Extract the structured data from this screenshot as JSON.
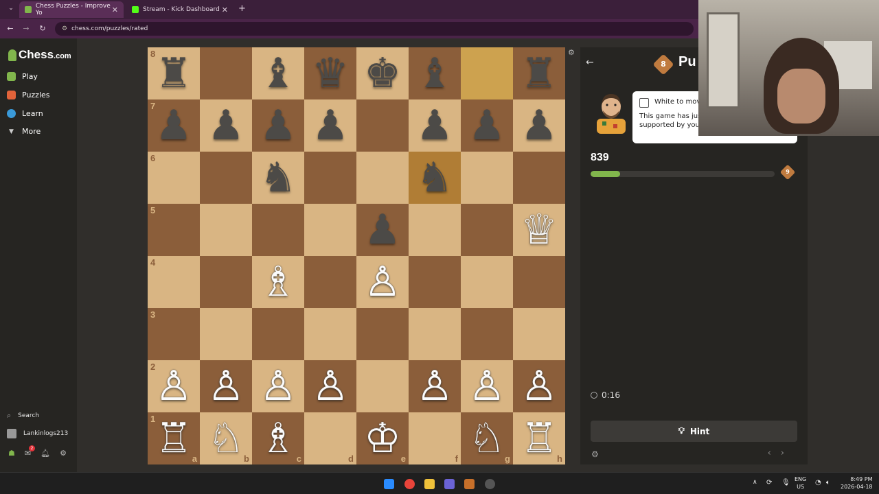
{
  "browser": {
    "tabs": [
      {
        "label": "Chess Puzzles - Improve Yo",
        "active": true
      },
      {
        "label": "Stream - Kick Dashboard",
        "active": false
      }
    ],
    "new_tab": "+",
    "url": "chess.com/puzzles/rated"
  },
  "sidebar": {
    "logo": "Chess",
    "logo_suffix": ".com",
    "items": [
      {
        "label": "Play",
        "color": "#81b64c"
      },
      {
        "label": "Puzzles",
        "color": "#e2633a"
      },
      {
        "label": "Learn",
        "color": "#3a9ad9"
      },
      {
        "label": "More",
        "color": "#cccccc"
      }
    ],
    "search_label": "Search",
    "username": "Lankinlogs213",
    "notification_count": "2"
  },
  "board": {
    "ranks": [
      "8",
      "7",
      "6",
      "5",
      "4",
      "3",
      "2",
      "1"
    ],
    "files": [
      "a",
      "b",
      "c",
      "d",
      "e",
      "f",
      "g",
      "h"
    ],
    "position": [
      [
        "♜",
        "",
        "♝",
        "♛",
        "♚",
        "♝",
        "",
        "♜"
      ],
      [
        "♟",
        "♟",
        "♟",
        "♟",
        "",
        "♟",
        "♟",
        "♟"
      ],
      [
        "",
        "",
        "♞",
        "",
        "",
        "♞",
        "",
        ""
      ],
      [
        "",
        "",
        "",
        "",
        "♟",
        "",
        "",
        "♕"
      ],
      [
        "",
        "",
        "♗",
        "",
        "♙",
        "",
        "",
        ""
      ],
      [
        "",
        "",
        "",
        "",
        "",
        "",
        "",
        ""
      ],
      [
        "♙",
        "♙",
        "♙",
        "♙",
        "",
        "♙",
        "♙",
        "♙"
      ],
      [
        "♖",
        "♘",
        "♗",
        "",
        "♔",
        "",
        "♘",
        "♖"
      ]
    ],
    "highlights": [
      "g8",
      "f6"
    ],
    "colors": {
      "light": "#d9b583",
      "dark": "#8b5e3a"
    }
  },
  "panel": {
    "title": "Pu",
    "badge": "8",
    "bubble_head": "White to mov",
    "bubble_body": "This game has just way to play checkm supported by your",
    "rating": "839",
    "progress": 0.16,
    "next_badge": "9",
    "timer": "0:16",
    "hint_label": "Hint"
  },
  "taskbar": {
    "lang": "ENG",
    "region": "US",
    "time": "8:49 PM",
    "date": "2026-04-18"
  }
}
